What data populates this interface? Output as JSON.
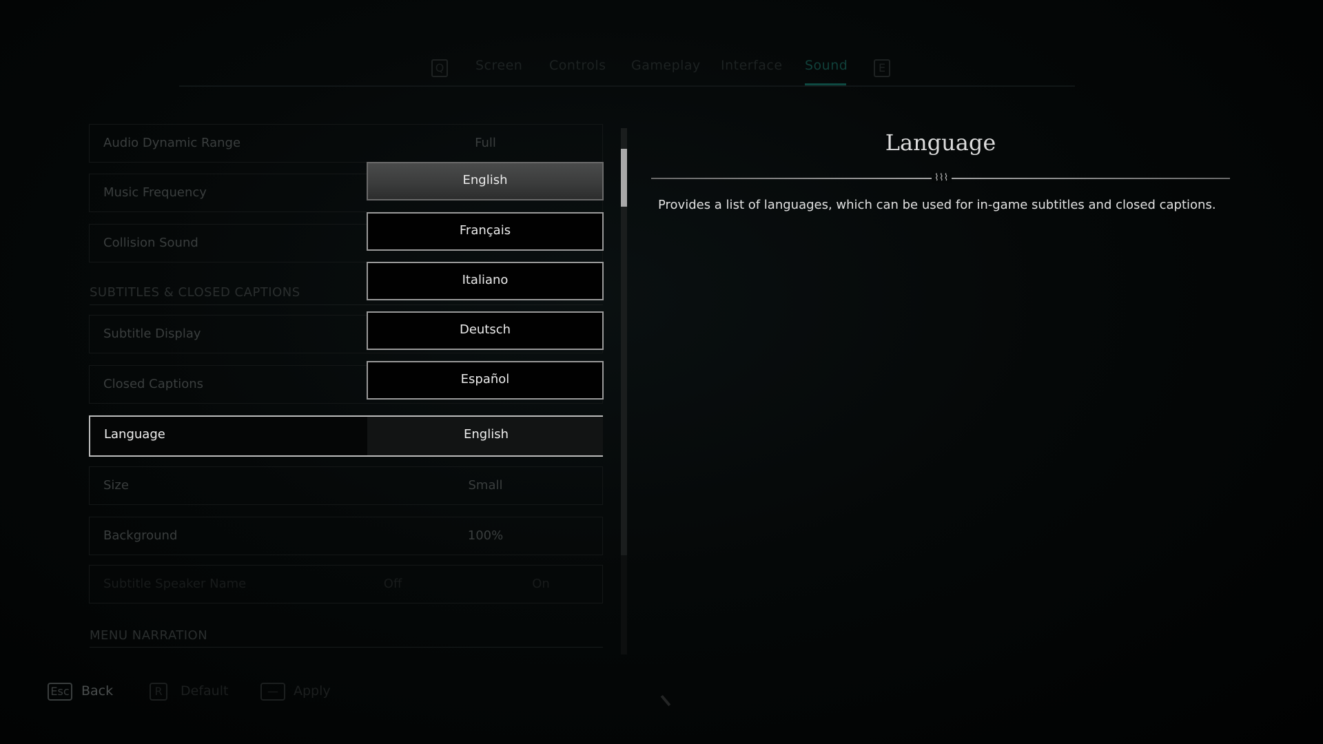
{
  "tabs": {
    "prev_key": "Q",
    "next_key": "E",
    "items": [
      {
        "label": "Screen",
        "active": false
      },
      {
        "label": "Controls",
        "active": false
      },
      {
        "label": "Gameplay",
        "active": false
      },
      {
        "label": "Interface",
        "active": false
      },
      {
        "label": "Sound",
        "active": true
      }
    ]
  },
  "settings": {
    "rows_top": [
      {
        "label": "Audio Dynamic Range",
        "value": "Full"
      },
      {
        "label": "Music Frequency",
        "value": ""
      },
      {
        "label": "Collision Sound",
        "value": ""
      }
    ],
    "section_subtitles": "SUBTITLES & CLOSED CAPTIONS",
    "rows_subtitles": [
      {
        "label": "Subtitle Display",
        "value": ""
      },
      {
        "label": "Closed Captions",
        "value": ""
      },
      {
        "label": "Language",
        "value": "English",
        "selected": true
      },
      {
        "label": "Size",
        "value": "Small"
      },
      {
        "label": "Background",
        "value": "100%"
      },
      {
        "label": "Subtitle Speaker Name",
        "value_off": "Off",
        "value_on": "On"
      }
    ],
    "section_menu_narration": "MENU NARRATION"
  },
  "language_dropdown": {
    "selected": "English",
    "options": [
      "English",
      "Français",
      "Italiano",
      "Deutsch",
      "Español"
    ]
  },
  "info": {
    "title": "Language",
    "ornament": "⌇⌇⌇",
    "description": "Provides a list of languages, which can be used for in-game subtitles and closed captions."
  },
  "footer": {
    "back": {
      "key": "Esc",
      "label": "Back"
    },
    "default": {
      "key": "R",
      "label": "Default"
    },
    "apply": {
      "key": "—",
      "label": "Apply"
    }
  }
}
